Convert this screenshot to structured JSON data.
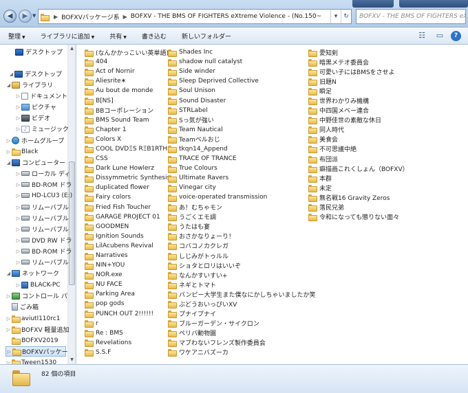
{
  "address": {
    "crumbs": [
      "BOFXVパッケージ系",
      "BOFXV - THE BMS OF FIGHTERS eXtreme Violence - (No.150~"
    ],
    "search_placeholder": "BOFXV - THE BMS OF FIGHTERS eX..."
  },
  "toolbar": {
    "organize": "整理",
    "add_to_library": "ライブラリに追加",
    "share": "共有",
    "burn": "書き込む",
    "new_folder": "新しいフォルダー",
    "view_icon": "view-options-icon",
    "preview_icon": "preview-pane-icon",
    "help": "?"
  },
  "nav": [
    {
      "label": "デスクトップ",
      "icon": "desktop-icon",
      "indent": 0,
      "twisty": ""
    },
    {
      "label": "デスクトップ",
      "icon": "desktop-icon",
      "indent": 0,
      "twisty": "◢"
    },
    {
      "label": "ライブラリ",
      "icon": "library-icon",
      "indent": 1,
      "twisty": "◢"
    },
    {
      "label": "ドキュメント",
      "icon": "document-icon",
      "indent": 2,
      "twisty": "▷"
    },
    {
      "label": "ピクチャ",
      "icon": "picture-icon",
      "indent": 2,
      "twisty": "▷"
    },
    {
      "label": "ビデオ",
      "icon": "video-icon",
      "indent": 2,
      "twisty": "▷"
    },
    {
      "label": "ミュージック",
      "icon": "music-icon",
      "indent": 2,
      "twisty": "▷"
    },
    {
      "label": "ホームグループ",
      "icon": "homegroup-icon",
      "indent": 1,
      "twisty": "▷"
    },
    {
      "label": "Black",
      "icon": "folder-icon",
      "indent": 1,
      "twisty": "▷"
    },
    {
      "label": "コンピューター",
      "icon": "computer-icon",
      "indent": 1,
      "twisty": "◢"
    },
    {
      "label": "ローカル ディ",
      "icon": "drive-icon",
      "indent": 2,
      "twisty": "▷"
    },
    {
      "label": "BD-ROM ドラ",
      "icon": "disc-icon",
      "indent": 2,
      "twisty": "▷"
    },
    {
      "label": "HD-LCU3 (E:)",
      "icon": "drive-icon",
      "indent": 2,
      "twisty": "▷"
    },
    {
      "label": "リムーバブル",
      "icon": "drive-icon",
      "indent": 2,
      "twisty": "▷"
    },
    {
      "label": "リムーバブル",
      "icon": "drive-icon",
      "indent": 2,
      "twisty": "▷"
    },
    {
      "label": "リムーバブル",
      "icon": "drive-icon",
      "indent": 2,
      "twisty": "▷"
    },
    {
      "label": "DVD RW ドラ",
      "icon": "disc-icon",
      "indent": 2,
      "twisty": "▷"
    },
    {
      "label": "BD-ROM ドラ",
      "icon": "disc-icon",
      "indent": 2,
      "twisty": "▷"
    },
    {
      "label": "リムーバブル",
      "icon": "drive-icon",
      "indent": 2,
      "twisty": "▷"
    },
    {
      "label": "ネットワーク",
      "icon": "network-icon",
      "indent": 1,
      "twisty": "◢"
    },
    {
      "label": "BLACK-PC",
      "icon": "pc-icon",
      "indent": 2,
      "twisty": "▷"
    },
    {
      "label": "コントロール パ",
      "icon": "control-panel-icon",
      "indent": 1,
      "twisty": "▷"
    },
    {
      "label": "ごみ箱",
      "icon": "recycle-bin-icon",
      "indent": 1,
      "twisty": ""
    },
    {
      "label": "aviutl110rc1",
      "icon": "folder-icon",
      "indent": 1,
      "twisty": "▷"
    },
    {
      "label": "BOFXV 軽量追加",
      "icon": "folder-icon",
      "indent": 1,
      "twisty": "▷"
    },
    {
      "label": "BOFXV2019",
      "icon": "folder-icon",
      "indent": 1,
      "twisty": ""
    },
    {
      "label": "BOFXVパッケー",
      "icon": "folder-icon",
      "indent": 1,
      "twisty": "▷",
      "selected": true
    },
    {
      "label": "Tween1530",
      "icon": "folder-icon",
      "indent": 1,
      "twisty": "▷"
    }
  ],
  "columns": [
    [
      "(なんかかっこいい英単語)",
      "404",
      "Act of Nornir",
      "Aliesrite∗",
      "Au bout de monde",
      "B[NS]",
      "BBコーポレーション",
      "BMS Sound Team",
      "Chapter 1",
      "Colors X",
      "COOL DVDΞS RΞB1RTH",
      "CSS",
      "Dark Lune Howlerz",
      "Dissymmetric Synthesis",
      "duplicated flower",
      "Fairy colors",
      "Fried Fish Toucher",
      "GARAGE PROJECT 01",
      "GOODMEN",
      "Ignition Sounds",
      "LilAcubens Revival",
      "Narratives",
      "NIN+YOU",
      "NOR.exe",
      "NU FACE",
      "Parking Area",
      "pop gods",
      "PUNCH OUT 2!!!!!!",
      "r",
      "Re : BMS",
      "Revelations",
      "S.S.F"
    ],
    [
      "Shades Inc",
      "shadow null catalyst",
      "Side winder",
      "Sleep Deprived Collective",
      "Soul Unison",
      "Sound Disaster",
      "STRLabel",
      "Sっ気が強い",
      "Team Nautical",
      "Teamベルおじ",
      "tkqn14_Append",
      "TRACE OF TRANCE",
      "True Colours",
      "Ultimate Ravers",
      "Vinegar city",
      "voice-operated transmission",
      "あ！むちゃモン",
      "うごくエモ調",
      "うたはも宴",
      "おさかなりょーり！",
      "コバコノカクレガ",
      "しじみがトゥルル",
      "ショタとロリはいいぞ",
      "なんかすいすい+",
      "ネギとトマト",
      "バンピー大学生また僕なにかしちゃいましたか笑",
      "ぶどうおいっぴいXV",
      "プナイプナイ",
      "ブルーガーデン・サイクロン",
      "ペリバ動物園",
      "マブわないフレンズ製作委員会",
      "ワケアニバズーカ"
    ],
    [
      "愛知剣",
      "暗黒メテオ委員会",
      "可愛い子にはBMSをさせよ",
      "旧題N",
      "瞬足",
      "世界わかりみ機構",
      "中四国メベー連合",
      "中野佳世の素敵な休日",
      "同人時代",
      "美食会",
      "不可思議中絶",
      "布団派",
      "癖描画これくしょん（BOFXV）",
      "本群",
      "未定",
      "無名戦16 Gravity Zeros",
      "落民兄弟",
      "令和になっても懲りない面々"
    ]
  ],
  "status": {
    "count_text": "82 個の項目"
  }
}
